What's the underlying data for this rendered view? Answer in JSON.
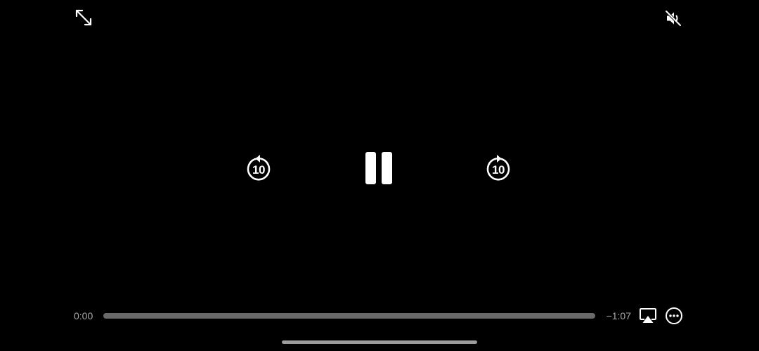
{
  "player": {
    "background_color": "#000000",
    "icon_color": "#ffffff",
    "top_controls": {
      "fullscreen_icon": "expand-arrows-icon",
      "mute_icon": "speaker-muted-icon"
    },
    "center_controls": {
      "skip_back_label": "10",
      "skip_back_icon": "rotate-left-icon",
      "play_pause_icon": "pause-icon",
      "skip_forward_label": "10",
      "skip_forward_icon": "rotate-right-icon"
    },
    "timeline": {
      "elapsed": "0:00",
      "remaining": "−1:07",
      "progress": 0.0,
      "track_color": "#6a6a6a",
      "fill_color": "#e6e6e6",
      "time_color": "#a9a9a9"
    },
    "bottom_controls": {
      "airplay_icon": "airplay-icon",
      "more_icon": "ellipsis-circle-icon"
    }
  }
}
